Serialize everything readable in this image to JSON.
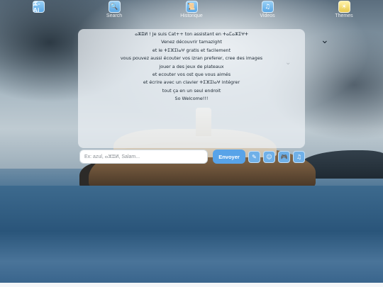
{
  "nav": {
    "items": [
      {
        "label": "",
        "icon": "ⵣ-Ai",
        "icon_name": "app-logo-icon"
      },
      {
        "label": "Search",
        "icon": "🔍",
        "icon_name": "search-icon"
      },
      {
        "label": "Historique",
        "icon": "📜",
        "icon_name": "history-icon"
      },
      {
        "label": "Videos",
        "icon": "♫",
        "icon_name": "music-note-icon"
      },
      {
        "label": "Themes",
        "icon": "☀",
        "icon_name": "theme-icon"
      }
    ]
  },
  "chat": {
    "lines": [
      "ⴰⵣⵓⵍ ! Je suis Cat++ ton assistant en ⵜⴰⵎⴰⵣⵉⵖⵜ",
      "Venez découvrir tamazight",
      "et le ⵜⵉⴼⵉⵏⴰⵖ gratis et facilement",
      "vous pouvez aussi écouter vos izran preferer, cree des images",
      "jouer a des jeux de plateaux",
      "et ecouter vos ost que vous aimés",
      "et écrire avec un clavier ⵜⵉⴼⵉⵏⴰⵖ intégrer",
      "tout ça en un seul endroit",
      "So Welcome!!!"
    ]
  },
  "input": {
    "placeholder": "Ex: azul, ⴰⵣⵓⵍ, Salam...",
    "value": "",
    "send_label": "Envoyer"
  },
  "tools": [
    {
      "icon": "✎",
      "icon_name": "pen-icon"
    },
    {
      "icon": "☺",
      "icon_name": "palette-icon"
    },
    {
      "icon": "🎮",
      "icon_name": "gamepad-icon"
    },
    {
      "icon": "♫",
      "icon_name": "music-icon"
    }
  ],
  "colors": {
    "accent": "#58a3e8",
    "panel": "#ebf0f4"
  }
}
